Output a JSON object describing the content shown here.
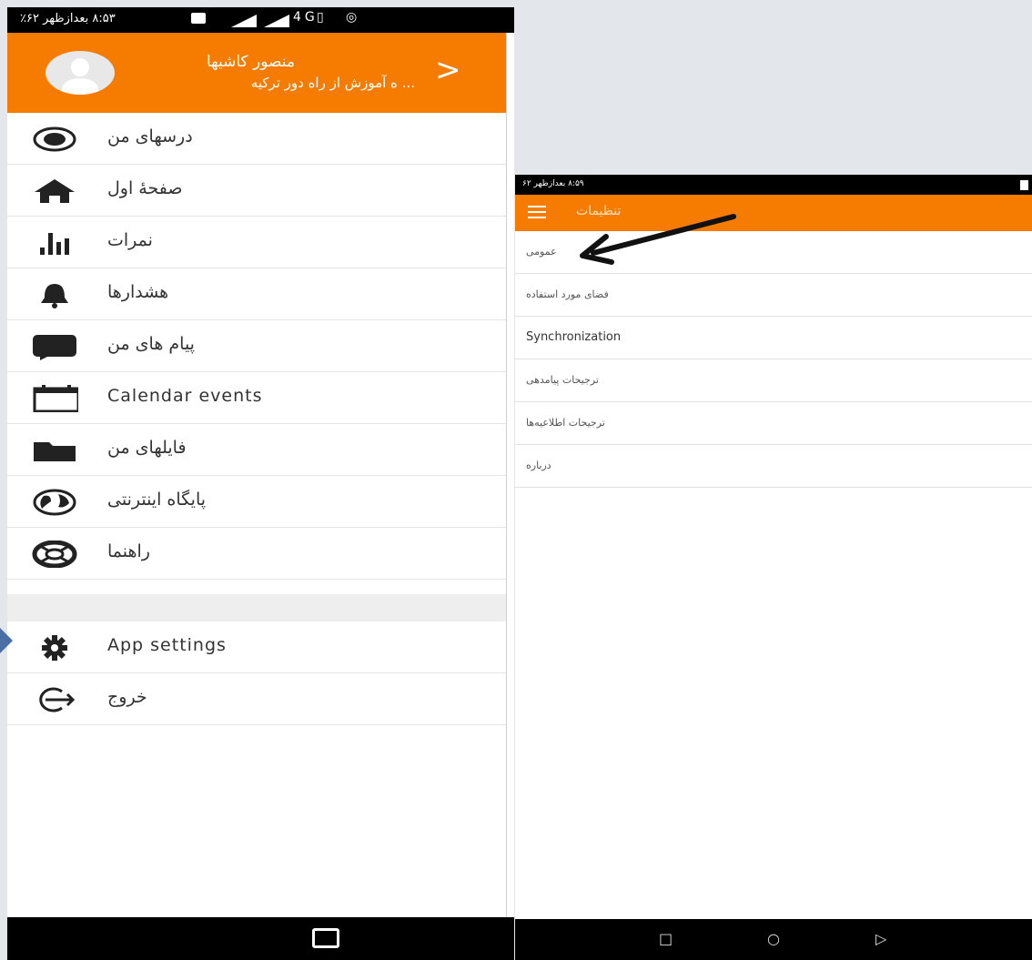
{
  "left": {
    "status_time": "۸:۵۳ بعدازظهر",
    "status_battery": "۶۲٪",
    "status_network": "4G",
    "user_name": "منصور کاشیها",
    "user_course": "... ه آموزش از راه دور ترکیه",
    "header_arrow": ">",
    "menu": [
      {
        "label": "درسهای من",
        "icon": "radio-button-icon"
      },
      {
        "label": "صفحهٔ اول",
        "icon": "home-icon"
      },
      {
        "label": "نمرات",
        "icon": "bar-chart-icon"
      },
      {
        "label": "هشدارها",
        "icon": "bell-icon"
      },
      {
        "label": "پیام های من",
        "icon": "message-icon"
      },
      {
        "label": "Calendar events",
        "icon": "calendar-icon"
      },
      {
        "label": "فایلهای من",
        "icon": "folder-icon"
      },
      {
        "label": "پایگاه اینترنتی",
        "icon": "globe-icon"
      },
      {
        "label": "راهنما",
        "icon": "lifebuoy-icon"
      }
    ],
    "bottom_menu": [
      {
        "label": "App settings",
        "icon": "gear-icon"
      },
      {
        "label": "خروج",
        "icon": "logout-icon"
      }
    ]
  },
  "right": {
    "status_time": "۸:۵۹ بعدازظهر",
    "status_battery": "۶۲",
    "title": "تنظیمات",
    "items": [
      {
        "label": "عمومی"
      },
      {
        "label": "فضای مورد استفاده"
      },
      {
        "label": "Synchronization"
      },
      {
        "label": "ترجیحات پیامدهی"
      },
      {
        "label": "ترجیحات اطلاعیه‌ها"
      },
      {
        "label": "درباره"
      }
    ]
  },
  "colors": {
    "accent": "#f57c00",
    "status_bar": "#000000",
    "background": "#e3e7ec",
    "arrow": "#111111"
  }
}
